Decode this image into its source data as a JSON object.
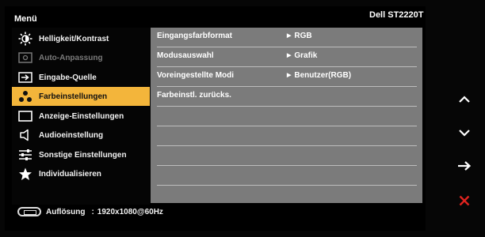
{
  "header": {
    "menu_label": "Menü",
    "model": "Dell ST2220T"
  },
  "sidebar": {
    "items": [
      {
        "label": "Helligkeit/Kontrast",
        "icon": "brightness-icon",
        "state": "normal"
      },
      {
        "label": "Auto-Anpassung",
        "icon": "auto-adjust-icon",
        "state": "disabled"
      },
      {
        "label": "Eingabe-Quelle",
        "icon": "input-source-icon",
        "state": "normal"
      },
      {
        "label": "Farbeinstellungen",
        "icon": "color-dots-icon",
        "state": "selected"
      },
      {
        "label": "Anzeige-Einstellungen",
        "icon": "display-icon",
        "state": "normal"
      },
      {
        "label": "Audioeinstellung",
        "icon": "speaker-icon",
        "state": "normal"
      },
      {
        "label": "Sonstige Einstellungen",
        "icon": "sliders-icon",
        "state": "normal"
      },
      {
        "label": "Individualisieren",
        "icon": "star-icon",
        "state": "normal"
      }
    ]
  },
  "panel": {
    "rows": [
      {
        "label": "Eingangsfarbformat",
        "value": "RGB"
      },
      {
        "label": "Modusauswahl",
        "value": "Grafik"
      },
      {
        "label": "Voreingestellte Modi",
        "value": "Benutzer(RGB)"
      },
      {
        "label": "Farbeinstl. zurücks.",
        "value": ""
      },
      {
        "label": "",
        "value": ""
      },
      {
        "label": "",
        "value": ""
      },
      {
        "label": "",
        "value": ""
      },
      {
        "label": "",
        "value": ""
      }
    ]
  },
  "status": {
    "label": "Auflösung",
    "separator": ":",
    "value": "1920x1080@60Hz"
  },
  "nav_buttons": [
    {
      "icon": "chevron-up-icon"
    },
    {
      "icon": "chevron-down-icon"
    },
    {
      "icon": "arrow-right-icon"
    },
    {
      "icon": "close-icon",
      "color": "#e0231f"
    }
  ],
  "colors": {
    "accent": "#f3b53b",
    "panel": "#7b7b7b",
    "exit": "#e0231f"
  }
}
